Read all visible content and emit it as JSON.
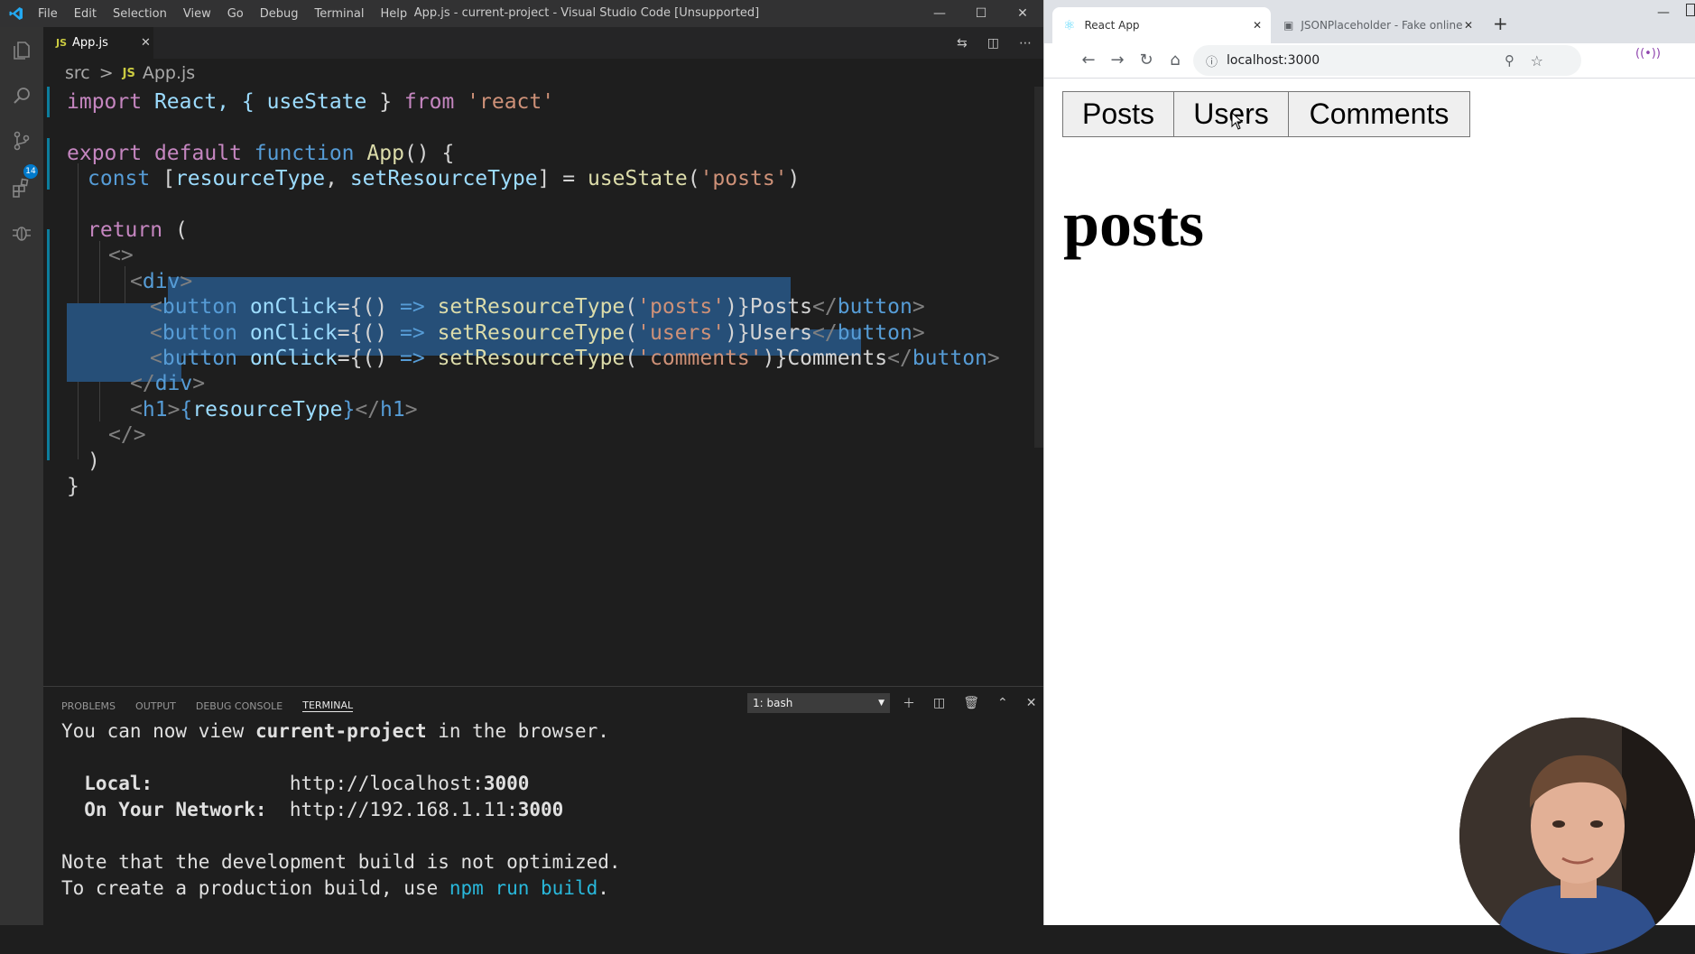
{
  "vscode": {
    "menu": [
      "File",
      "Edit",
      "Selection",
      "View",
      "Go",
      "Debug",
      "Terminal",
      "Help"
    ],
    "window_title": "App.js - current-project - Visual Studio Code [Unsupported]",
    "activity_badge": "14",
    "tab": {
      "badge": "JS",
      "label": "App.js"
    },
    "breadcrumb": {
      "folder": "src",
      "sep": ">",
      "badge": "JS",
      "file": "App.js"
    },
    "code": {
      "l1": [
        "import",
        " React, { ",
        "useState",
        " } ",
        "from",
        " ",
        "'react'"
      ],
      "l3": [
        "export",
        " ",
        "default",
        " ",
        "function",
        " ",
        "App",
        "() {"
      ],
      "l4": [
        "const",
        " [",
        "resourceType",
        ", ",
        "setResourceType",
        "] = ",
        "useState",
        "(",
        "'posts'",
        ")"
      ],
      "l6": [
        "return",
        " ("
      ],
      "l7": "<>",
      "l8": [
        "<",
        "div",
        ">"
      ],
      "l9": [
        "<",
        "button",
        " ",
        "onClick",
        "={() ",
        "=>",
        " ",
        "setResourceType",
        "(",
        "'posts'",
        ")}",
        "Posts",
        "</",
        "button",
        ">"
      ],
      "l10": [
        "<",
        "button",
        " ",
        "onClick",
        "={() ",
        "=>",
        " ",
        "setResourceType",
        "(",
        "'users'",
        ")}",
        "Users",
        "</",
        "button",
        ">"
      ],
      "l11": [
        "<",
        "button",
        " ",
        "onClick",
        "={() ",
        "=>",
        " ",
        "setResourceType",
        "(",
        "'comments'",
        ")}",
        "Comments",
        "</",
        "button",
        ">"
      ],
      "l12": [
        "</",
        "div",
        ">"
      ],
      "l13": [
        "<",
        "h1",
        ">",
        "{",
        "resourceType",
        "}",
        "</",
        "h1",
        ">"
      ],
      "l14": "</>",
      "l15": ")",
      "l16": "}"
    },
    "panel_tabs": [
      "PROBLEMS",
      "OUTPUT",
      "DEBUG CONSOLE",
      "TERMINAL"
    ],
    "active_panel_tab": "TERMINAL",
    "terminal_select": "1: bash",
    "terminal": {
      "line1": [
        "You can now view ",
        "current-project",
        " in the browser."
      ],
      "local_label": "  Local:            ",
      "local_url": [
        "http://localhost:",
        "3000"
      ],
      "network_label": "  On Your Network:  ",
      "network_url": [
        "http://192.168.1.11:",
        "3000"
      ],
      "note1": "Note that the development build is not optimized.",
      "note2": [
        "To create a production build, use ",
        "npm run build",
        "."
      ]
    }
  },
  "browser": {
    "tab1_title": "React App",
    "tab2_title": "JSONPlaceholder - Fake online R",
    "address": "localhost:3000",
    "buttons": [
      "Posts",
      "Users",
      "Comments"
    ],
    "heading": "posts"
  },
  "colors": {
    "accent": "#007acc",
    "selection": "#264f78",
    "string": "#ce9178",
    "keyword": "#569cd6"
  }
}
